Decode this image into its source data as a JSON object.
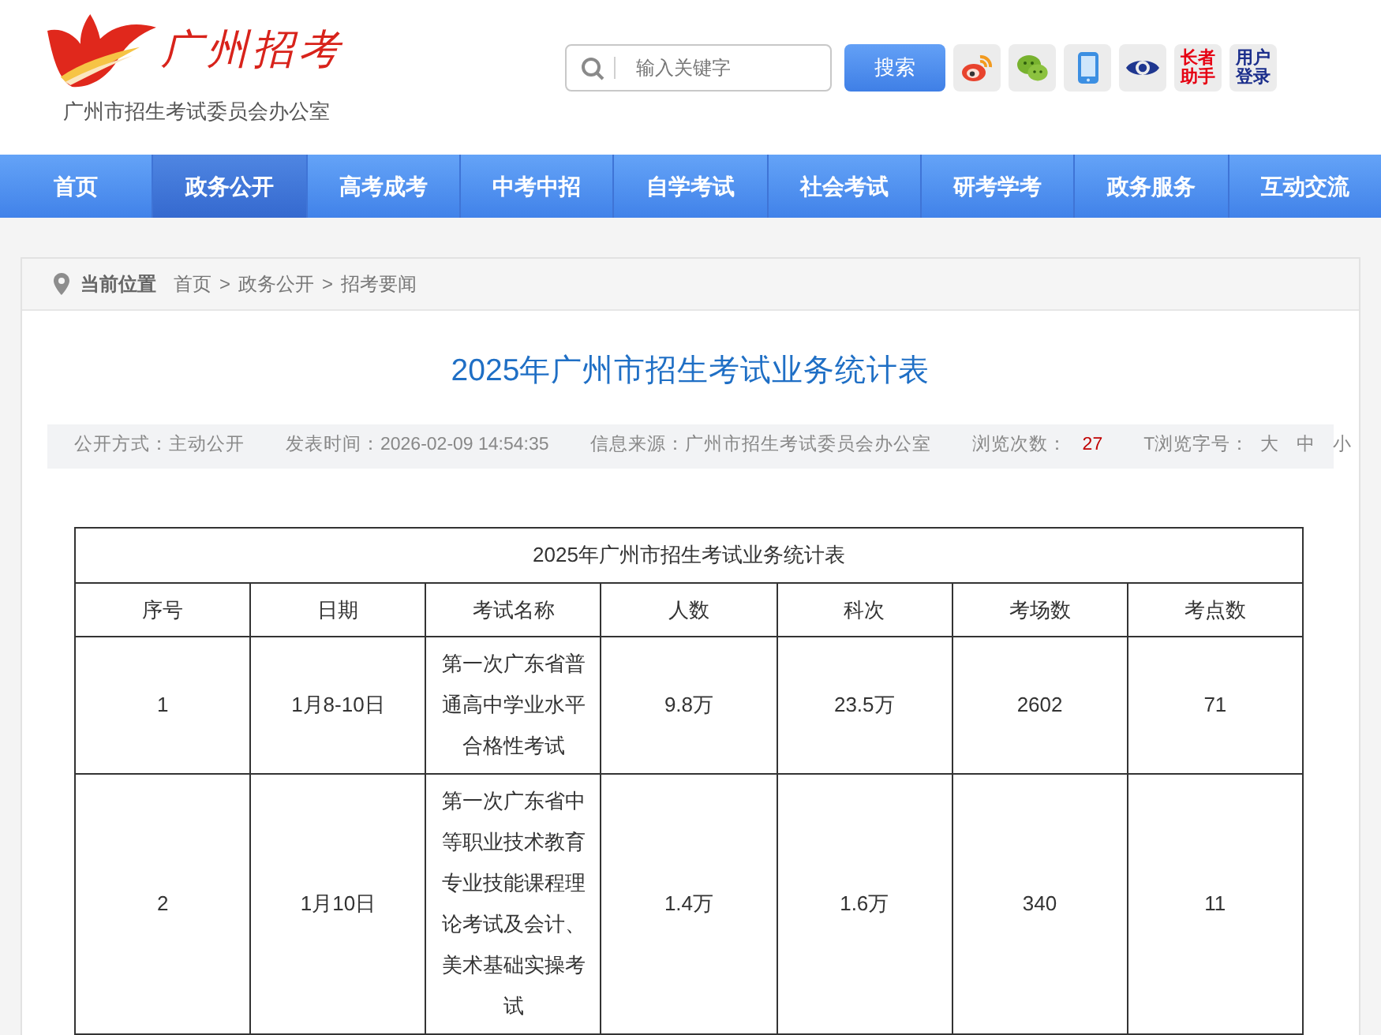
{
  "header": {
    "logo_text": "广州招考",
    "subtitle": "广州市招生考试委员会办公室",
    "search": {
      "placeholder": "输入关键字",
      "button": "搜索"
    },
    "quick_links": [
      {
        "kind": "weibo"
      },
      {
        "kind": "wechat"
      },
      {
        "kind": "mobile"
      },
      {
        "kind": "eye"
      },
      {
        "kind": "text",
        "label": "长者助手",
        "color": "#e60012"
      },
      {
        "kind": "text",
        "label": "用户登录",
        "color": "#1c2f8c"
      }
    ]
  },
  "nav": [
    {
      "label": "首页",
      "selected": false
    },
    {
      "label": "政务公开",
      "selected": true
    },
    {
      "label": "高考成考",
      "selected": false
    },
    {
      "label": "中考中招",
      "selected": false
    },
    {
      "label": "自学考试",
      "selected": false
    },
    {
      "label": "社会考试",
      "selected": false
    },
    {
      "label": "研考学考",
      "selected": false
    },
    {
      "label": "政务服务",
      "selected": false
    },
    {
      "label": "互动交流",
      "selected": false
    }
  ],
  "breadcrumb": {
    "label": "当前位置",
    "crumbs": [
      {
        "kind": "link",
        "text": "首页"
      },
      {
        "kind": "separator",
        "text": ">"
      },
      {
        "kind": "link",
        "text": "政务公开"
      },
      {
        "kind": "separator",
        "text": ">"
      },
      {
        "kind": "link",
        "text": "招考要闻"
      }
    ]
  },
  "article": {
    "title": "2025年广州市招生考试业务统计表",
    "meta": [
      {
        "kind": "text",
        "text": "公开方式：主动公开"
      },
      {
        "kind": "text",
        "text": "发表时间：2026-02-09 14:54:35"
      },
      {
        "kind": "text",
        "text": "信息来源：广州市招生考试委员会办公室"
      },
      {
        "kind": "label",
        "text": "浏览次数："
      },
      {
        "kind": "count",
        "text": "27"
      },
      {
        "kind": "label",
        "text": "T浏览字号："
      },
      {
        "kind": "option",
        "text": "大"
      },
      {
        "kind": "option",
        "text": "中"
      },
      {
        "kind": "option",
        "text": "小"
      }
    ],
    "table": {
      "caption": "2025年广州市招生考试业务统计表",
      "columns": [
        "序号",
        "日期",
        "考试名称",
        "人数",
        "科次",
        "考场数",
        "考点数"
      ],
      "rows": [
        [
          "1",
          "1月8-10日",
          "第一次广东省普通高中学业水平合格性考试",
          "9.8万",
          "23.5万",
          "2602",
          "71"
        ],
        [
          "2",
          "1月10日",
          "第一次广东省中等职业技术教育专业技能课程理论考试及会计、美术基础实操考试",
          "1.4万",
          "1.6万",
          "340",
          "11"
        ]
      ]
    }
  }
}
